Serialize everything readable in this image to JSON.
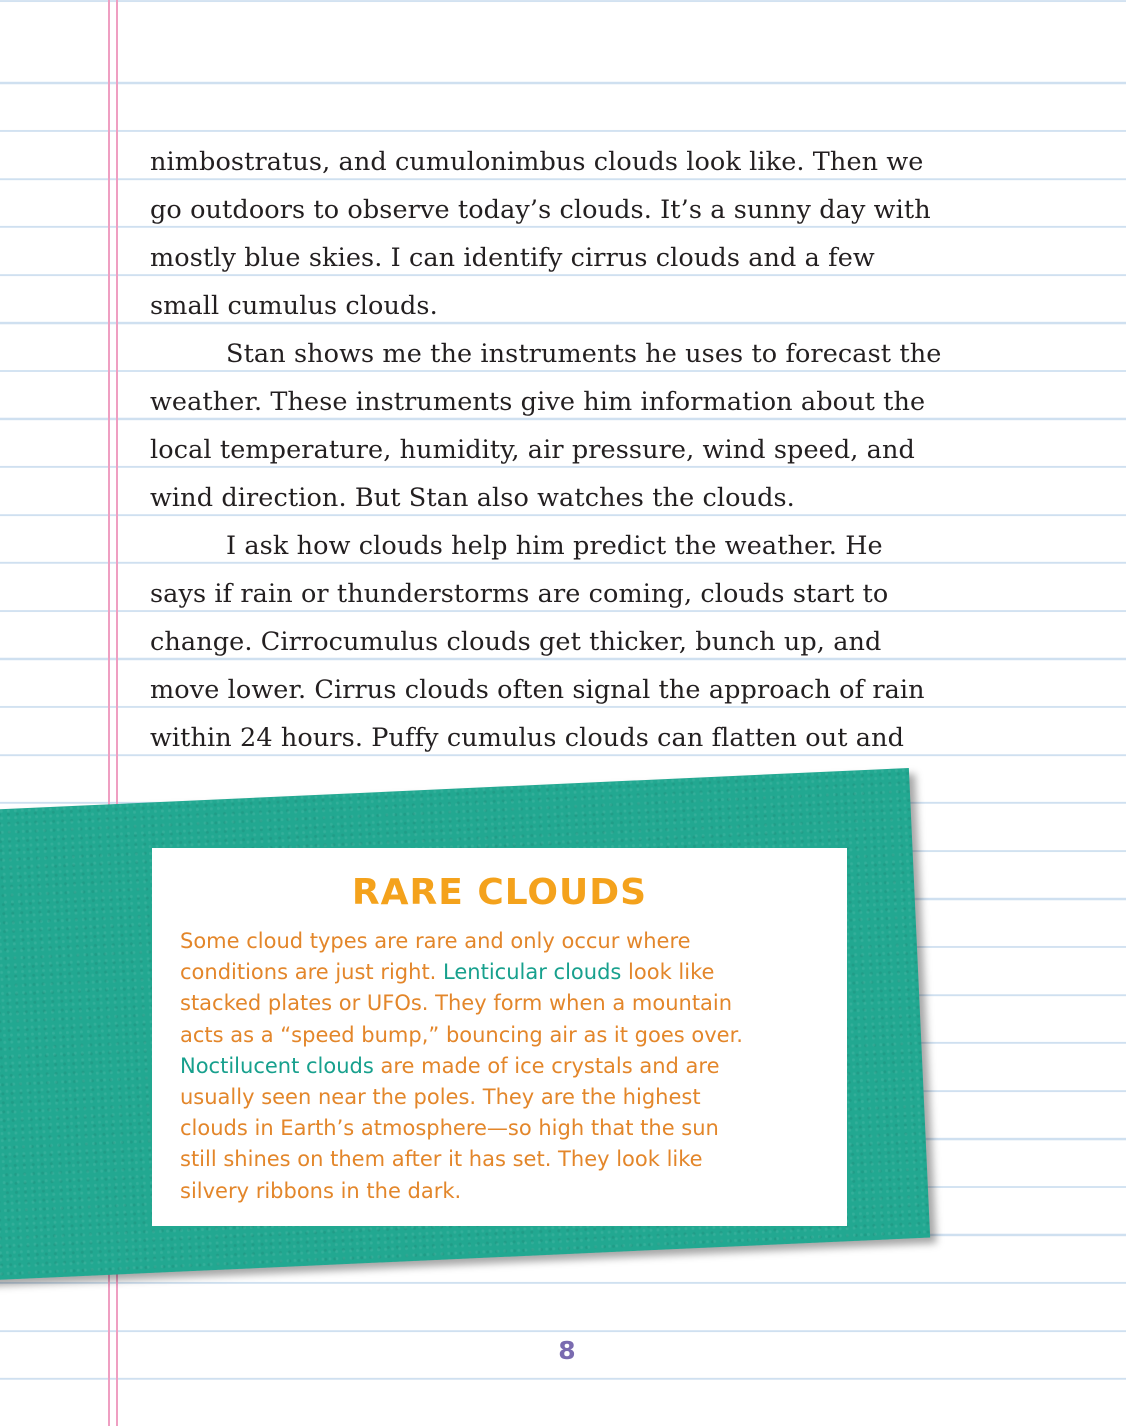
{
  "body": {
    "lines": [
      "nimbostratus, and cumulonimbus clouds look like. Then we",
      "go outdoors to observe today’s clouds. It’s a sunny day with",
      "mostly blue skies. I can identify cirrus clouds and a few",
      "small cumulus clouds.",
      "Stan shows me the instruments he uses to forecast the",
      "weather. These instruments give him information about the",
      "local temperature, humidity, air pressure, wind speed, and",
      "wind direction. But Stan also watches the clouds.",
      "I ask how clouds help him predict the weather. He",
      "says if rain or thunderstorms are coming, clouds start to",
      "change. Cirrocumulus clouds get thicker, bunch up, and",
      "move lower. Cirrus clouds often signal the approach of rain",
      "within 24 hours. Puffy cumulus clouds can flatten out and"
    ]
  },
  "sidebar": {
    "title": "RARE CLOUDS",
    "lines": [
      {
        "pre": "Some cloud types are rare and only occur where",
        "hl": "",
        "post": ""
      },
      {
        "pre": "conditions are just right. ",
        "hl": "Lenticular clouds",
        "post": " look like"
      },
      {
        "pre": "stacked plates or UFOs. They form when a mountain",
        "hl": "",
        "post": ""
      },
      {
        "pre": "acts as a “speed bump,” bouncing air as it goes over.",
        "hl": "",
        "post": ""
      },
      {
        "pre": "",
        "hl": "Noctilucent clouds",
        "post": " are made of ice crystals and are"
      },
      {
        "pre": "usually seen near the poles. They are the highest",
        "hl": "",
        "post": ""
      },
      {
        "pre": "clouds in Earth’s atmosphere—so high that the sun",
        "hl": "",
        "post": ""
      },
      {
        "pre": "still shines on them after it has set. They look like",
        "hl": "",
        "post": ""
      },
      {
        "pre": "silvery ribbons in the dark.",
        "hl": "",
        "post": ""
      }
    ]
  },
  "page_number": "8",
  "colors": {
    "teal": "#22a891",
    "sidebar_text": "#e3862a",
    "sidebar_highlight": "#17a08d",
    "title": "#f4a21c",
    "page_number": "#7a6bb0",
    "rule_line": "#cfe0f0",
    "margin_line": "#ef9fc2"
  }
}
